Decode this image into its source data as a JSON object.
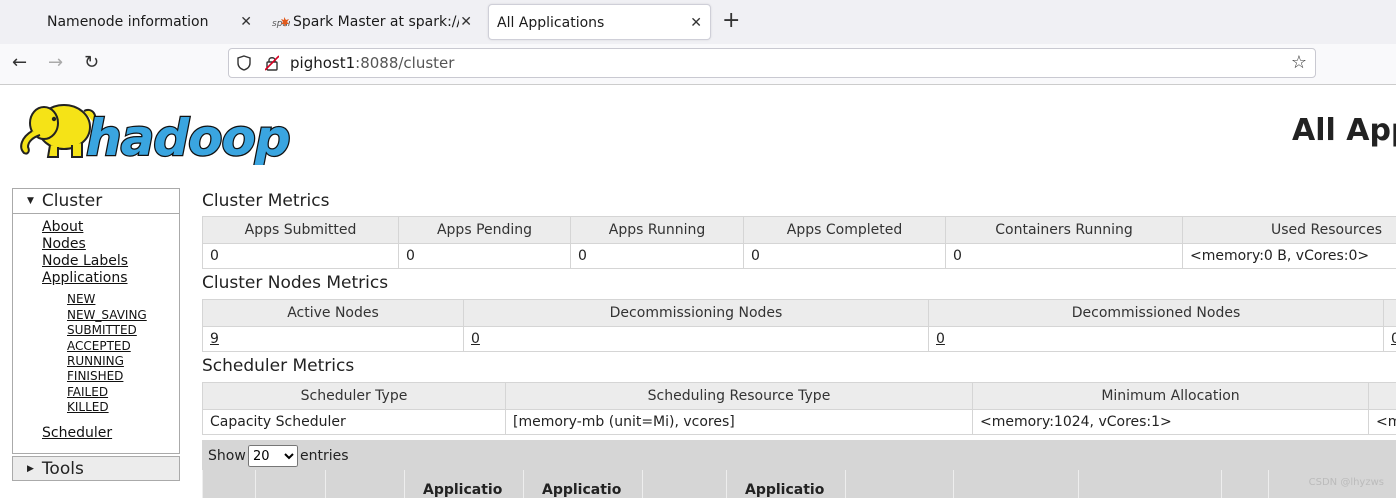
{
  "browser": {
    "tabs": [
      {
        "label": "Namenode information",
        "active": false
      },
      {
        "label": "Spark Master at spark://pi",
        "active": false
      },
      {
        "label": "All Applications",
        "active": true
      }
    ],
    "url_host": "pighost1",
    "url_rest": ":8088/cluster"
  },
  "page": {
    "logo_text": "hadoop",
    "title": "All App"
  },
  "sidebar": {
    "cluster_header": "Cluster",
    "links": [
      "About",
      "Nodes",
      "Node Labels",
      "Applications"
    ],
    "app_states": [
      "NEW",
      "NEW_SAVING",
      "SUBMITTED",
      "ACCEPTED",
      "RUNNING",
      "FINISHED",
      "FAILED",
      "KILLED"
    ],
    "scheduler": "Scheduler",
    "tools_header": "Tools"
  },
  "cluster_metrics": {
    "title": "Cluster Metrics",
    "headers": [
      "Apps Submitted",
      "Apps Pending",
      "Apps Running",
      "Apps Completed",
      "Containers Running",
      "Used Resources"
    ],
    "values": [
      "0",
      "0",
      "0",
      "0",
      "0",
      "<memory:0 B, vCores:0>"
    ]
  },
  "node_metrics": {
    "title": "Cluster Nodes Metrics",
    "headers": [
      "Active Nodes",
      "Decommissioning Nodes",
      "Decommissioned Nodes",
      ""
    ],
    "values": [
      "9",
      "0",
      "0",
      "0"
    ]
  },
  "scheduler_metrics": {
    "title": "Scheduler Metrics",
    "headers": [
      "Scheduler Type",
      "Scheduling Resource Type",
      "Minimum Allocation",
      ""
    ],
    "values": [
      "Capacity Scheduler",
      "[memory-mb (unit=Mi), vcores]",
      "<memory:1024, vCores:1>",
      "<m"
    ]
  },
  "apps_table": {
    "show_label": "Show",
    "page_size": "20",
    "entries_label": "entries",
    "columns": [
      "",
      "",
      "",
      "Applicatio",
      "Applicatio",
      "",
      "Applicatio",
      "",
      "",
      "",
      "",
      ""
    ]
  },
  "watermark": "CSDN @lhyzws"
}
